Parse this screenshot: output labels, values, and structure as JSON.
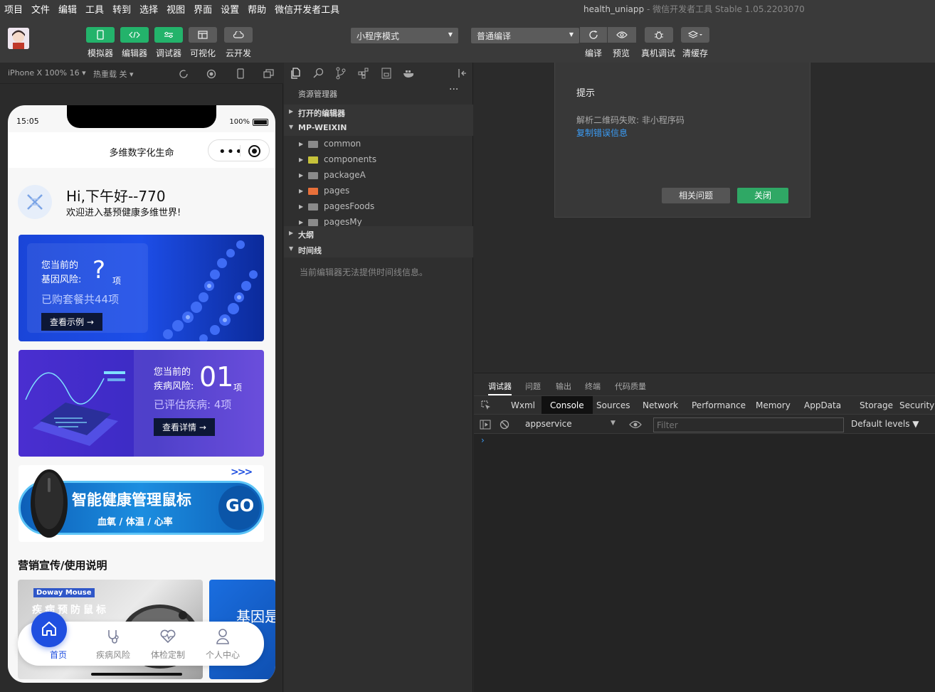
{
  "menu": [
    "项目",
    "文件",
    "编辑",
    "工具",
    "转到",
    "选择",
    "视图",
    "界面",
    "设置",
    "帮助",
    "微信开发者工具"
  ],
  "window": {
    "project": "health_uniapp",
    "sep": " - ",
    "app": "微信开发者工具 Stable 1.05.2203070"
  },
  "toolbar": {
    "simulator": "模拟器",
    "editor": "编辑器",
    "debugger": "调试器",
    "visual": "可视化",
    "cloud": "云开发",
    "mode": "小程序模式",
    "compile_mode": "普通编译",
    "compile": "编译",
    "preview": "预览",
    "remote_debug": "真机调试",
    "clear_cache": "清缓存"
  },
  "simbar": {
    "device": "iPhone X 100% 16 ▾",
    "hotreload": "热重载 关 ▾"
  },
  "phone": {
    "time": "15:05",
    "battery": "100%",
    "nav_title": "多维数字化生命",
    "greet_title": "Hi,下午好--770",
    "greet_sub": "欢迎进入基预健康多维世界!",
    "card1": {
      "l1": "您当前的",
      "l2": "基因风险:",
      "q": "?",
      "unit": "项",
      "sub": "已购套餐共44项",
      "btn": "查看示例 →"
    },
    "card2": {
      "l1": "您当前的",
      "l2": "疾病风险:",
      "num": "01",
      "unit": "项",
      "sub": "已评估疾病: 4项",
      "btn": "查看详情 →"
    },
    "banner": {
      "title": "智能健康管理鼠标",
      "sub": "血氧 / 体温 / 心率",
      "go": "GO",
      "chev": ">>>"
    },
    "marketing_title": "营销宣传/使用说明",
    "mk1": {
      "brand": "Doway Mouse",
      "text": "疾病预防鼠标"
    },
    "mk2": {
      "text": "基因是"
    },
    "tabs": [
      {
        "label": "首页",
        "active": true
      },
      {
        "label": "疾病风险"
      },
      {
        "label": "体检定制"
      },
      {
        "label": "个人中心"
      }
    ]
  },
  "explorer": {
    "title": "资源管理器",
    "more": "···",
    "open_editors": "打开的编辑器",
    "project": "MP-WEIXIN",
    "files": [
      "common",
      "components",
      "packageA",
      "pages",
      "pagesFoods",
      "pagesMy"
    ],
    "outline": "大纲",
    "timeline": "时间线",
    "timeline_msg": "当前编辑器无法提供时间线信息。"
  },
  "dialog": {
    "title": "提示",
    "message": "解析二维码失败: 非小程序码",
    "link": "复制错误信息",
    "related": "相关问题",
    "close": "关闭"
  },
  "debugger": {
    "top_tabs": [
      "调试器",
      "问题",
      "输出",
      "终端",
      "代码质量"
    ],
    "panel_tabs": [
      "Wxml",
      "Console",
      "Sources",
      "Network",
      "Performance",
      "Memory",
      "AppData",
      "Storage",
      "Security"
    ],
    "context": "appservice",
    "filter_placeholder": "Filter",
    "levels": "Default levels ▼",
    "prompt": "›"
  },
  "colors": {
    "accent_green": "#23b36b",
    "link_blue": "#3b9cf5",
    "tab_blue": "#1f4fe0"
  }
}
